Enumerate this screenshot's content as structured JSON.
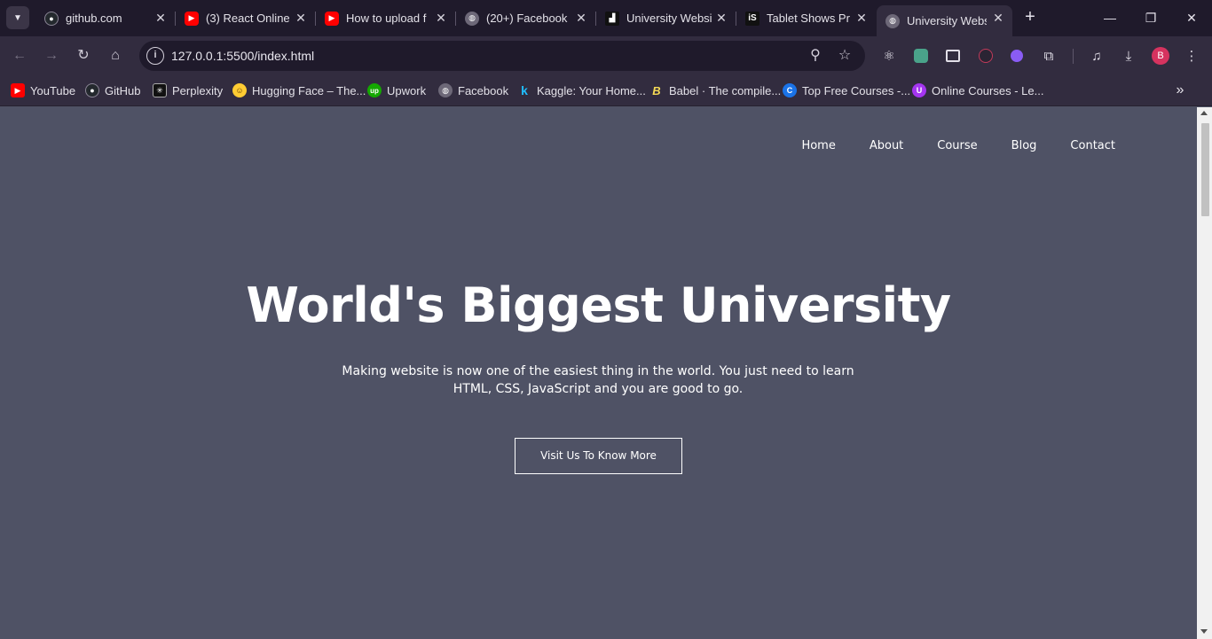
{
  "tabs": [
    {
      "title": "github.com",
      "icon": "github-icon",
      "color": "#24292e",
      "glyph": "●"
    },
    {
      "title": "(3) React Online",
      "icon": "youtube-icon",
      "color": "#ff0000",
      "glyph": "▶"
    },
    {
      "title": "How to upload f",
      "icon": "youtube-icon",
      "color": "#ff0000",
      "glyph": "▶"
    },
    {
      "title": "(20+) Facebook",
      "icon": "globe-icon",
      "color": "#6d6878",
      "glyph": "◍"
    },
    {
      "title": "University Websi",
      "icon": "university-icon",
      "color": "#111111",
      "glyph": "▟"
    },
    {
      "title": "Tablet Shows Pr",
      "icon": "is-logo-icon",
      "color": "#111111",
      "glyph": "iS"
    },
    {
      "title": "University Websi",
      "icon": "globe-icon",
      "color": "#6d6878",
      "glyph": "◍"
    }
  ],
  "address": {
    "url": "127.0.0.1:5500/index.html"
  },
  "profile": {
    "initial": "B"
  },
  "bookmarks": [
    {
      "label": "YouTube",
      "icon": "youtube-icon",
      "color": "#ff0000",
      "glyph": "▶"
    },
    {
      "label": "GitHub",
      "icon": "github-icon",
      "color": "#24292e",
      "glyph": "●"
    },
    {
      "label": "Perplexity",
      "icon": "perplexity-icon",
      "color": "#111111",
      "glyph": "✳"
    },
    {
      "label": "Hugging Face – The...",
      "icon": "hugging-face-icon",
      "color": "#ffcc33",
      "glyph": "☺"
    },
    {
      "label": "Upwork",
      "icon": "upwork-icon",
      "color": "#14a800",
      "glyph": "up"
    },
    {
      "label": "Facebook",
      "icon": "globe-icon",
      "color": "#6d6878",
      "glyph": "◍"
    },
    {
      "label": "Kaggle: Your Home...",
      "icon": "kaggle-icon",
      "color": "#20beff",
      "glyph": "k"
    },
    {
      "label": "Babel · The compile...",
      "icon": "babel-icon",
      "color": "#f5da55",
      "glyph": "B"
    },
    {
      "label": "Top Free Courses -...",
      "icon": "courses-icon",
      "color": "#1a73e8",
      "glyph": "C"
    },
    {
      "label": "Online Courses - Le...",
      "icon": "udemy-icon",
      "color": "#a435f0",
      "glyph": "U"
    }
  ],
  "site": {
    "nav": [
      "Home",
      "About",
      "Course",
      "Blog",
      "Contact"
    ],
    "hero_title": "World's Biggest University",
    "hero_text": "Making website is now one of the easiest thing in the world. You just need to learn HTML, CSS, JavaScript and you are good to go.",
    "cta": "Visit Us To Know More"
  },
  "colors": {
    "page_bg": "#4f5265",
    "chrome_dark": "#1f1a2b",
    "chrome": "#322c3f"
  }
}
